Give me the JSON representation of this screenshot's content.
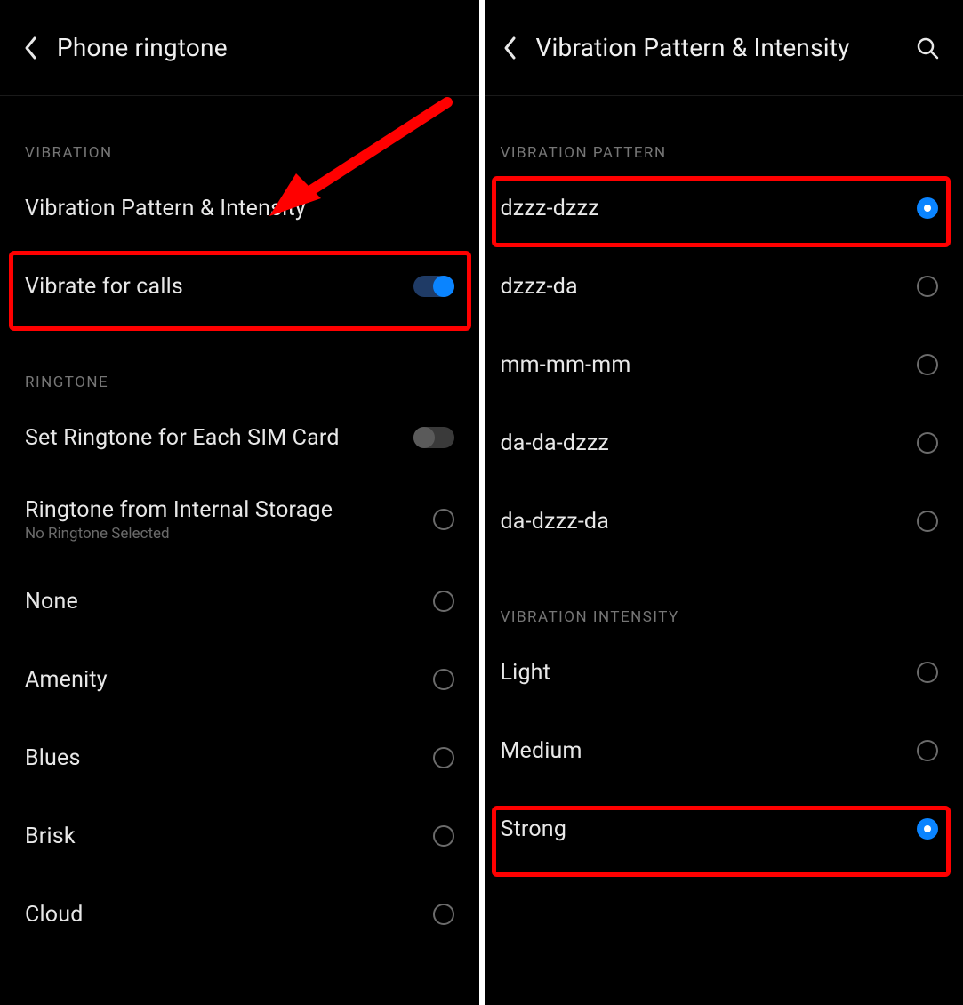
{
  "left": {
    "title": "Phone ringtone",
    "sections": {
      "vibration": {
        "header": "VIBRATION",
        "pattern_row": "Vibration Pattern & Intensity",
        "vibrate_calls_label": "Vibrate for calls",
        "vibrate_calls_on": true
      },
      "ringtone": {
        "header": "RINGTONE",
        "set_per_sim_label": "Set Ringtone for Each SIM Card",
        "set_per_sim_on": false,
        "from_storage_label": "Ringtone from Internal Storage",
        "from_storage_sub": "No Ringtone Selected",
        "options": [
          "None",
          "Amenity",
          "Blues",
          "Brisk",
          "Cloud"
        ]
      }
    }
  },
  "right": {
    "title": "Vibration Pattern & Intensity",
    "sections": {
      "pattern": {
        "header": "VIBRATION PATTERN",
        "options": [
          "dzzz-dzzz",
          "dzzz-da",
          "mm-mm-mm",
          "da-da-dzzz",
          "da-dzzz-da"
        ],
        "selected": "dzzz-dzzz"
      },
      "intensity": {
        "header": "VIBRATION INTENSITY",
        "options": [
          "Light",
          "Medium",
          "Strong"
        ],
        "selected": "Strong"
      }
    }
  }
}
